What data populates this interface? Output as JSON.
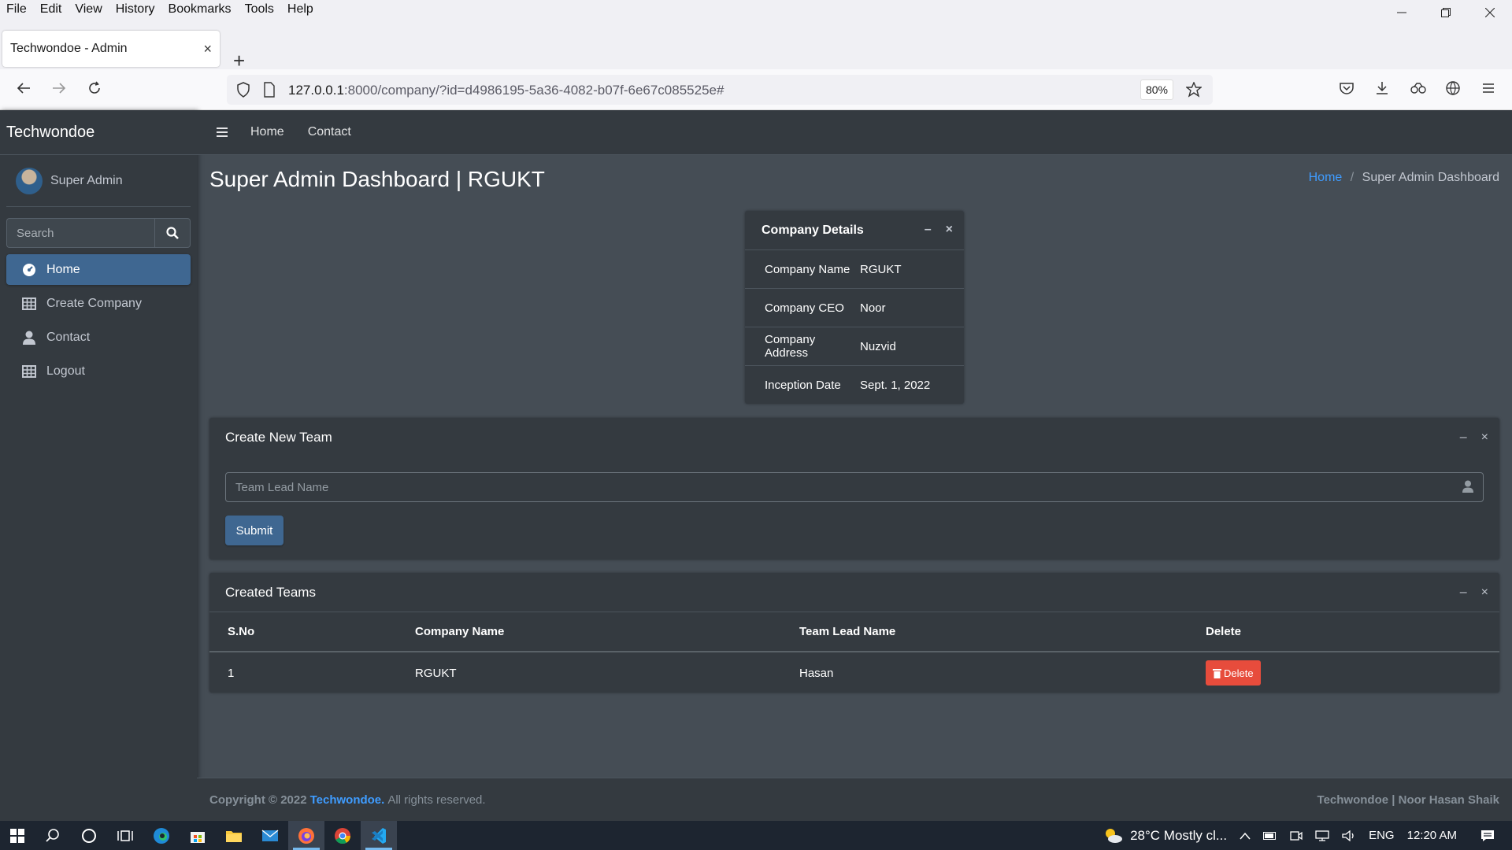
{
  "browser": {
    "menu": [
      "File",
      "Edit",
      "View",
      "History",
      "Bookmarks",
      "Tools",
      "Help"
    ],
    "tab_title": "Techwondoe - Admin",
    "url_host": "127.0.0.1",
    "url_rest": ":8000/company/?id=d4986195-5a36-4082-b07f-6e67c085525e#",
    "zoom": "80%"
  },
  "sidebar": {
    "brand": "Techwondoe",
    "user": "Super Admin",
    "search_placeholder": "Search",
    "items": [
      {
        "label": "Home",
        "icon": "dashboard-icon",
        "active": true
      },
      {
        "label": "Create Company",
        "icon": "table-icon"
      },
      {
        "label": "Contact",
        "icon": "user-icon"
      },
      {
        "label": "Logout",
        "icon": "table-icon"
      }
    ]
  },
  "topnav": {
    "home": "Home",
    "contact": "Contact"
  },
  "page": {
    "title": "Super Admin Dashboard | RGUKT",
    "breadcrumb_home": "Home",
    "breadcrumb_sep": "/",
    "breadcrumb_current": "Super Admin Dashboard"
  },
  "company_details": {
    "title": "Company Details",
    "rows": [
      {
        "key": "Company Name",
        "value": "RGUKT"
      },
      {
        "key": "Company CEO",
        "value": "Noor"
      },
      {
        "key": "Company Address",
        "value": "Nuzvid"
      },
      {
        "key": "Inception Date",
        "value": "Sept. 1, 2022"
      }
    ]
  },
  "create_team": {
    "title": "Create New Team",
    "placeholder": "Team Lead Name",
    "submit": "Submit"
  },
  "created_teams": {
    "title": "Created Teams",
    "headers": [
      "S.No",
      "Company Name",
      "Team Lead Name",
      "Delete"
    ],
    "rows": [
      {
        "sno": "1",
        "company": "RGUKT",
        "lead": "Hasan",
        "action": "Delete"
      }
    ]
  },
  "footer": {
    "copyright": "Copyright © 2022",
    "brand": "Techwondoe.",
    "rights": "All rights reserved.",
    "right": "Techwondoe | Noor Hasan Shaik"
  },
  "taskbar": {
    "weather": "28°C  Mostly cl...",
    "lang": "ENG",
    "time": "12:20 AM"
  },
  "colors": {
    "primary": "#3f6791",
    "danger": "#e74c3c",
    "link": "#3f9cff",
    "sidebar": "#343a40",
    "content": "#454d55"
  }
}
